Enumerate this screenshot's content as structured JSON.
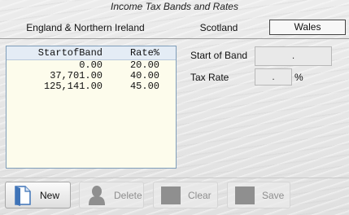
{
  "window": {
    "title": "Income Tax Bands and Rates"
  },
  "tabs": [
    {
      "label": "England & Northern Ireland"
    },
    {
      "label": "Scotland"
    },
    {
      "label": "Wales"
    }
  ],
  "bands_table": {
    "columns": [
      "StartofBand",
      "Rate%"
    ],
    "rows": [
      {
        "start": "0.00",
        "rate": "20.00"
      },
      {
        "start": "37,701.00",
        "rate": "40.00"
      },
      {
        "start": "125,141.00",
        "rate": "45.00"
      }
    ]
  },
  "form": {
    "start_label": "Start of Band",
    "start_value": ".",
    "rate_label": "Tax Rate",
    "rate_value": ".",
    "rate_unit": "%"
  },
  "toolbar": {
    "new_label": "New",
    "delete_label": "Delete",
    "clear_label": "Clear",
    "save_label": "Save"
  },
  "icons": {
    "new": "new-document-icon",
    "delete": "delete-user-icon",
    "clear": "clear-icon",
    "save": "save-icon"
  },
  "colors": {
    "list_background": "#fdfcec",
    "list_header": "#e4ecf5",
    "new_icon_blue": "#3f74b8"
  }
}
